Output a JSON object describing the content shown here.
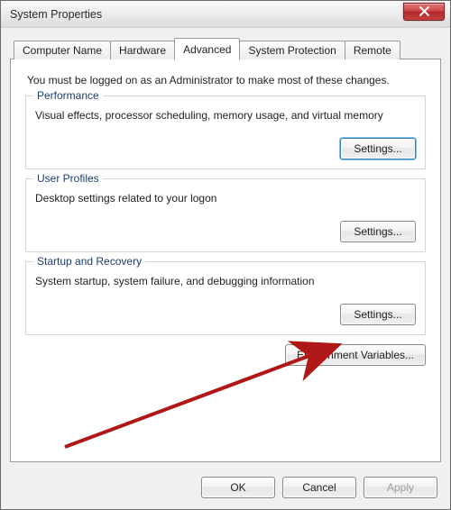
{
  "window": {
    "title": "System Properties"
  },
  "tabs": [
    {
      "label": "Computer Name"
    },
    {
      "label": "Hardware"
    },
    {
      "label": "Advanced"
    },
    {
      "label": "System Protection"
    },
    {
      "label": "Remote"
    }
  ],
  "active_tab_index": 2,
  "intro": "You must be logged on as an Administrator to make most of these changes.",
  "groups": {
    "performance": {
      "legend": "Performance",
      "desc": "Visual effects, processor scheduling, memory usage, and virtual memory",
      "button": "Settings..."
    },
    "profiles": {
      "legend": "User Profiles",
      "desc": "Desktop settings related to your logon",
      "button": "Settings..."
    },
    "startup": {
      "legend": "Startup and Recovery",
      "desc": "System startup, system failure, and debugging information",
      "button": "Settings..."
    }
  },
  "env_button": "Environment Variables...",
  "buttons": {
    "ok": "OK",
    "cancel": "Cancel",
    "apply": "Apply"
  }
}
